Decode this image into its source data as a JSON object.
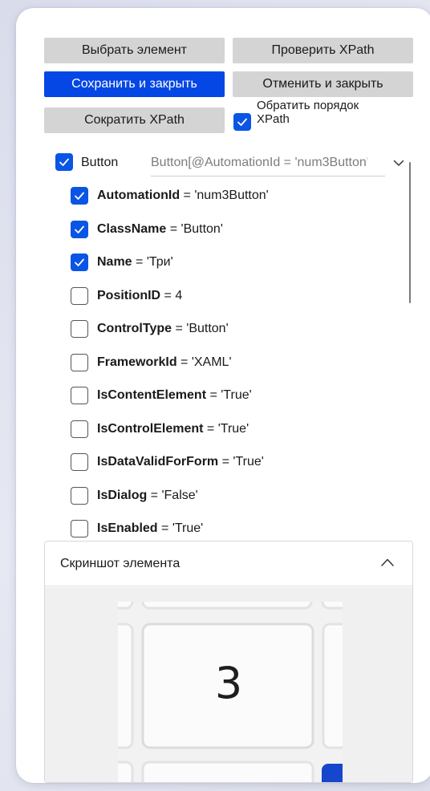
{
  "toolbar": {
    "select_element": "Выбрать элемент",
    "check_xpath": "Проверить XPath",
    "save_close": "Сохранить и закрыть",
    "cancel_close": "Отменить и закрыть",
    "shorten_xpath": "Сократить XPath",
    "reverse_order_line1": "Обратить порядок",
    "reverse_order_line2": "XPath",
    "reverse_order_checked": true
  },
  "root": {
    "label": "Button",
    "checked": true,
    "xpath": "Button[@AutomationId = 'num3Button']"
  },
  "properties": [
    {
      "name": "AutomationId",
      "value": " = 'num3Button'",
      "checked": true
    },
    {
      "name": "ClassName",
      "value": " = 'Button'",
      "checked": true
    },
    {
      "name": "Name",
      "value": " = 'Три'",
      "checked": true
    },
    {
      "name": "PositionID",
      "value": " = 4",
      "checked": false
    },
    {
      "name": "ControlType",
      "value": " = 'Button'",
      "checked": false
    },
    {
      "name": "FrameworkId",
      "value": " = 'XAML'",
      "checked": false
    },
    {
      "name": "IsContentElement",
      "value": " = 'True'",
      "checked": false
    },
    {
      "name": "IsControlElement",
      "value": " = 'True'",
      "checked": false
    },
    {
      "name": "IsDataValidForForm",
      "value": " = 'True'",
      "checked": false
    },
    {
      "name": "IsDialog",
      "value": " = 'False'",
      "checked": false
    },
    {
      "name": "IsEnabled",
      "value": " = 'True'",
      "checked": false
    }
  ],
  "screenshot": {
    "title": "Скриншот элемента",
    "key_label": "3"
  },
  "colors": {
    "primary": "#0547e4",
    "checkbox_on": "#0a55e6",
    "button_gray": "#d4d4d4"
  }
}
